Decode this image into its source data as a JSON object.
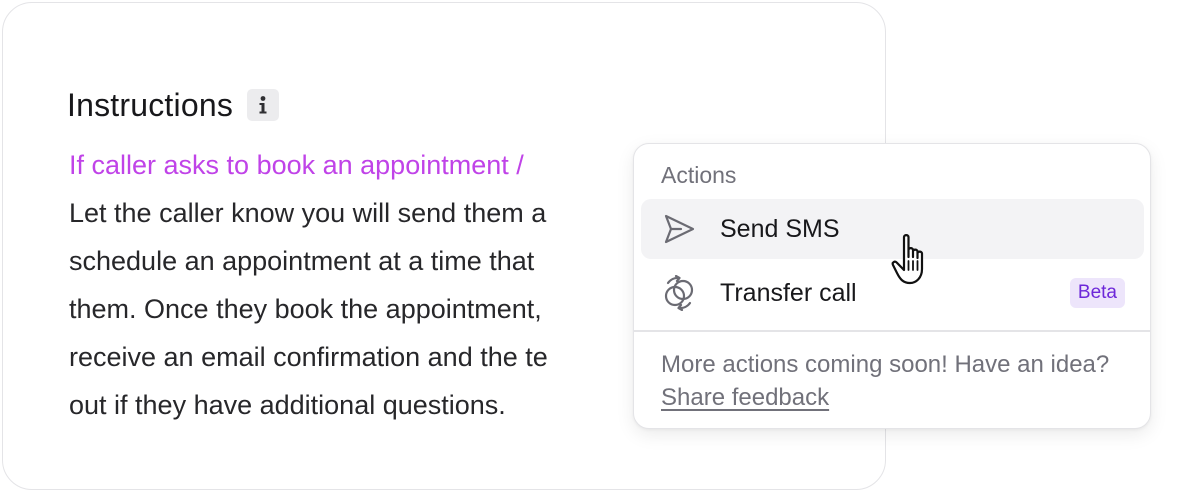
{
  "instructions": {
    "title": "Instructions",
    "lines": [
      "If caller asks to book an appointment /",
      "Let the caller know you will send them a",
      "schedule an appointment at a time that",
      "them. Once they book the appointment,",
      "receive an email confirmation and the te",
      "out if they have additional questions."
    ]
  },
  "actions_menu": {
    "section_title": "Actions",
    "items": [
      {
        "label": "Send SMS",
        "icon": "send-icon",
        "badge": ""
      },
      {
        "label": "Transfer call",
        "icon": "transfer-call-icon",
        "badge": "Beta"
      }
    ],
    "footer_text": "More actions coming soon! Have an idea?",
    "footer_link": "Share feedback"
  },
  "colors": {
    "trigger_text": "#c043e8",
    "beta_badge_bg": "#ede5fb",
    "beta_badge_text": "#6d28d9",
    "hover_bg": "#f3f3f5"
  }
}
